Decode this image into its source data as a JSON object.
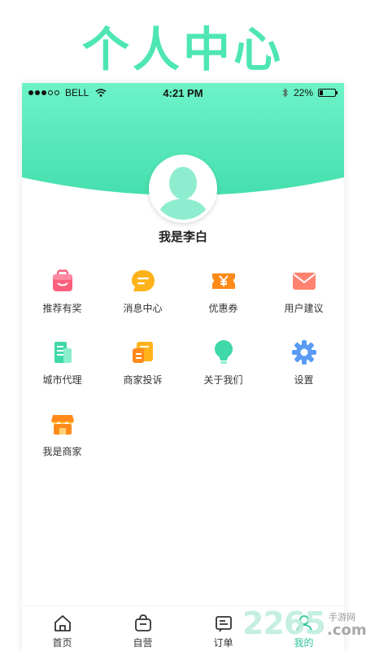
{
  "promo": {
    "title": "个人中心"
  },
  "status_bar": {
    "carrier": "BELL",
    "time": "4:21 PM",
    "battery": "22%",
    "battery_level": 0.22
  },
  "profile": {
    "name": "我是李白"
  },
  "menu": [
    {
      "label": "推荐有奖",
      "icon": "gift-bag-icon"
    },
    {
      "label": "消息中心",
      "icon": "message-bubble-icon"
    },
    {
      "label": "优惠券",
      "icon": "coupon-yen-icon"
    },
    {
      "label": "用户建议",
      "icon": "envelope-icon"
    },
    {
      "label": "城市代理",
      "icon": "building-icon"
    },
    {
      "label": "商家投诉",
      "icon": "complaint-document-icon"
    },
    {
      "label": "关于我们",
      "icon": "lightbulb-icon"
    },
    {
      "label": "设置",
      "icon": "gear-icon"
    },
    {
      "label": "我是商家",
      "icon": "storefront-icon"
    }
  ],
  "tabbar": {
    "items": [
      {
        "label": "首页",
        "icon": "home-icon"
      },
      {
        "label": "自营",
        "icon": "shopping-bag-icon"
      },
      {
        "label": "订单",
        "icon": "order-list-icon"
      },
      {
        "label": "我的",
        "icon": "user-icon",
        "active": true
      }
    ]
  },
  "colors": {
    "accent": "#4de6b4",
    "active_tab": "#2cc49a"
  },
  "watermark": {
    "number": "2265",
    "site": "手游网",
    "tld": ".com"
  }
}
